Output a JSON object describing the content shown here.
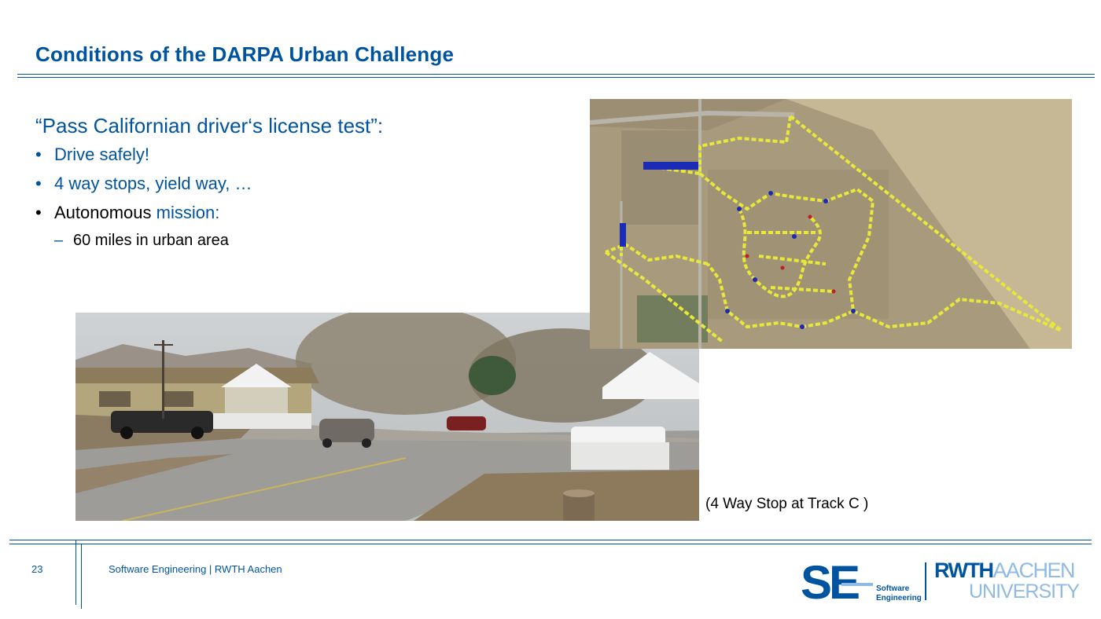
{
  "slide": {
    "title": "Conditions of the DARPA Urban Challenge",
    "heading": "“Pass Californian driver‘s license test”:",
    "bullets": [
      "Drive safely!",
      "4 way stops, yield way, …"
    ],
    "bullet3_a": "Autonomous ",
    "bullet3_b": "mission:",
    "sub_bullet": "60 miles in urban area",
    "caption": "(4 Way Stop at Track C )"
  },
  "footer": {
    "page_number": "23",
    "text": "Software Engineering  |  RWTH Aachen",
    "se_logo": "SE",
    "se_line1": "Software",
    "se_line2": "Engineering",
    "rwth_a": "RWTH",
    "rwth_b": "AACHEN",
    "rwth_c": "UNIVERSITY"
  },
  "colors": {
    "accent": "#00549f",
    "light_accent": "#8ebae5",
    "route": "#e8e83a"
  }
}
